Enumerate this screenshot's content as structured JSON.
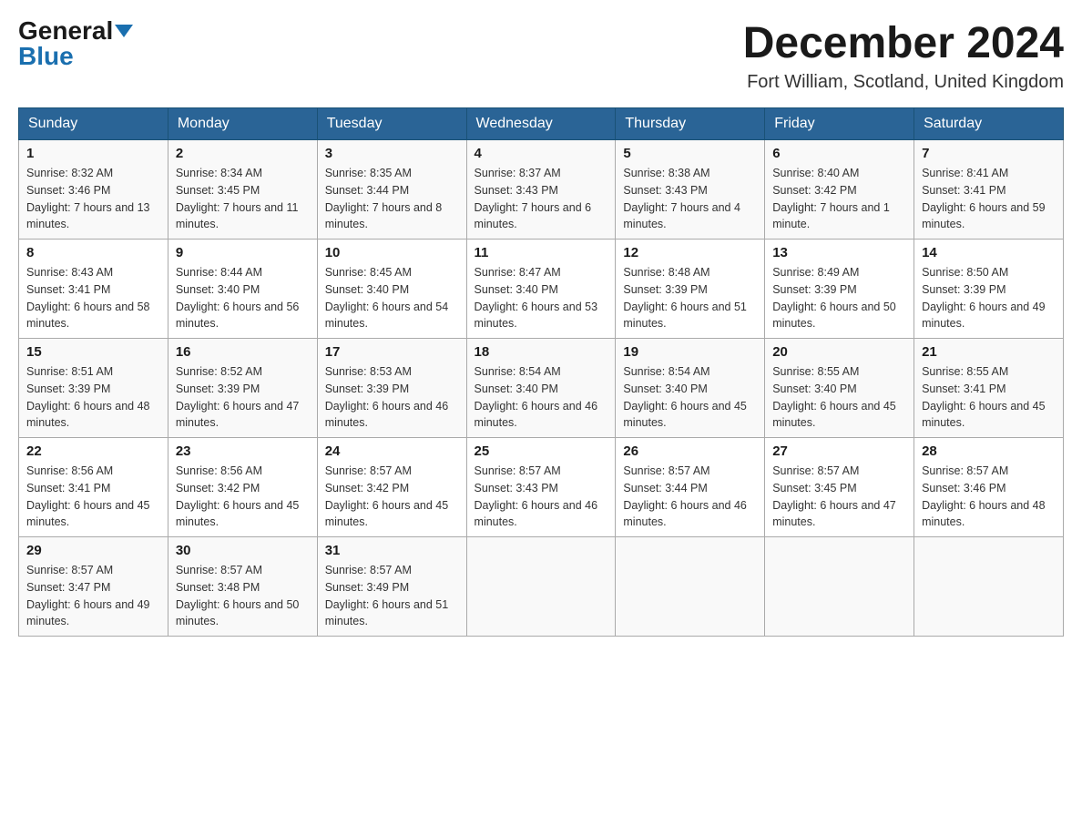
{
  "header": {
    "logo_general": "General",
    "logo_blue": "Blue",
    "month_year": "December 2024",
    "location": "Fort William, Scotland, United Kingdom"
  },
  "weekdays": [
    "Sunday",
    "Monday",
    "Tuesday",
    "Wednesday",
    "Thursday",
    "Friday",
    "Saturday"
  ],
  "weeks": [
    [
      {
        "day": "1",
        "sunrise": "8:32 AM",
        "sunset": "3:46 PM",
        "daylight": "7 hours and 13 minutes."
      },
      {
        "day": "2",
        "sunrise": "8:34 AM",
        "sunset": "3:45 PM",
        "daylight": "7 hours and 11 minutes."
      },
      {
        "day": "3",
        "sunrise": "8:35 AM",
        "sunset": "3:44 PM",
        "daylight": "7 hours and 8 minutes."
      },
      {
        "day": "4",
        "sunrise": "8:37 AM",
        "sunset": "3:43 PM",
        "daylight": "7 hours and 6 minutes."
      },
      {
        "day": "5",
        "sunrise": "8:38 AM",
        "sunset": "3:43 PM",
        "daylight": "7 hours and 4 minutes."
      },
      {
        "day": "6",
        "sunrise": "8:40 AM",
        "sunset": "3:42 PM",
        "daylight": "7 hours and 1 minute."
      },
      {
        "day": "7",
        "sunrise": "8:41 AM",
        "sunset": "3:41 PM",
        "daylight": "6 hours and 59 minutes."
      }
    ],
    [
      {
        "day": "8",
        "sunrise": "8:43 AM",
        "sunset": "3:41 PM",
        "daylight": "6 hours and 58 minutes."
      },
      {
        "day": "9",
        "sunrise": "8:44 AM",
        "sunset": "3:40 PM",
        "daylight": "6 hours and 56 minutes."
      },
      {
        "day": "10",
        "sunrise": "8:45 AM",
        "sunset": "3:40 PM",
        "daylight": "6 hours and 54 minutes."
      },
      {
        "day": "11",
        "sunrise": "8:47 AM",
        "sunset": "3:40 PM",
        "daylight": "6 hours and 53 minutes."
      },
      {
        "day": "12",
        "sunrise": "8:48 AM",
        "sunset": "3:39 PM",
        "daylight": "6 hours and 51 minutes."
      },
      {
        "day": "13",
        "sunrise": "8:49 AM",
        "sunset": "3:39 PM",
        "daylight": "6 hours and 50 minutes."
      },
      {
        "day": "14",
        "sunrise": "8:50 AM",
        "sunset": "3:39 PM",
        "daylight": "6 hours and 49 minutes."
      }
    ],
    [
      {
        "day": "15",
        "sunrise": "8:51 AM",
        "sunset": "3:39 PM",
        "daylight": "6 hours and 48 minutes."
      },
      {
        "day": "16",
        "sunrise": "8:52 AM",
        "sunset": "3:39 PM",
        "daylight": "6 hours and 47 minutes."
      },
      {
        "day": "17",
        "sunrise": "8:53 AM",
        "sunset": "3:39 PM",
        "daylight": "6 hours and 46 minutes."
      },
      {
        "day": "18",
        "sunrise": "8:54 AM",
        "sunset": "3:40 PM",
        "daylight": "6 hours and 46 minutes."
      },
      {
        "day": "19",
        "sunrise": "8:54 AM",
        "sunset": "3:40 PM",
        "daylight": "6 hours and 45 minutes."
      },
      {
        "day": "20",
        "sunrise": "8:55 AM",
        "sunset": "3:40 PM",
        "daylight": "6 hours and 45 minutes."
      },
      {
        "day": "21",
        "sunrise": "8:55 AM",
        "sunset": "3:41 PM",
        "daylight": "6 hours and 45 minutes."
      }
    ],
    [
      {
        "day": "22",
        "sunrise": "8:56 AM",
        "sunset": "3:41 PM",
        "daylight": "6 hours and 45 minutes."
      },
      {
        "day": "23",
        "sunrise": "8:56 AM",
        "sunset": "3:42 PM",
        "daylight": "6 hours and 45 minutes."
      },
      {
        "day": "24",
        "sunrise": "8:57 AM",
        "sunset": "3:42 PM",
        "daylight": "6 hours and 45 minutes."
      },
      {
        "day": "25",
        "sunrise": "8:57 AM",
        "sunset": "3:43 PM",
        "daylight": "6 hours and 46 minutes."
      },
      {
        "day": "26",
        "sunrise": "8:57 AM",
        "sunset": "3:44 PM",
        "daylight": "6 hours and 46 minutes."
      },
      {
        "day": "27",
        "sunrise": "8:57 AM",
        "sunset": "3:45 PM",
        "daylight": "6 hours and 47 minutes."
      },
      {
        "day": "28",
        "sunrise": "8:57 AM",
        "sunset": "3:46 PM",
        "daylight": "6 hours and 48 minutes."
      }
    ],
    [
      {
        "day": "29",
        "sunrise": "8:57 AM",
        "sunset": "3:47 PM",
        "daylight": "6 hours and 49 minutes."
      },
      {
        "day": "30",
        "sunrise": "8:57 AM",
        "sunset": "3:48 PM",
        "daylight": "6 hours and 50 minutes."
      },
      {
        "day": "31",
        "sunrise": "8:57 AM",
        "sunset": "3:49 PM",
        "daylight": "6 hours and 51 minutes."
      },
      null,
      null,
      null,
      null
    ]
  ]
}
